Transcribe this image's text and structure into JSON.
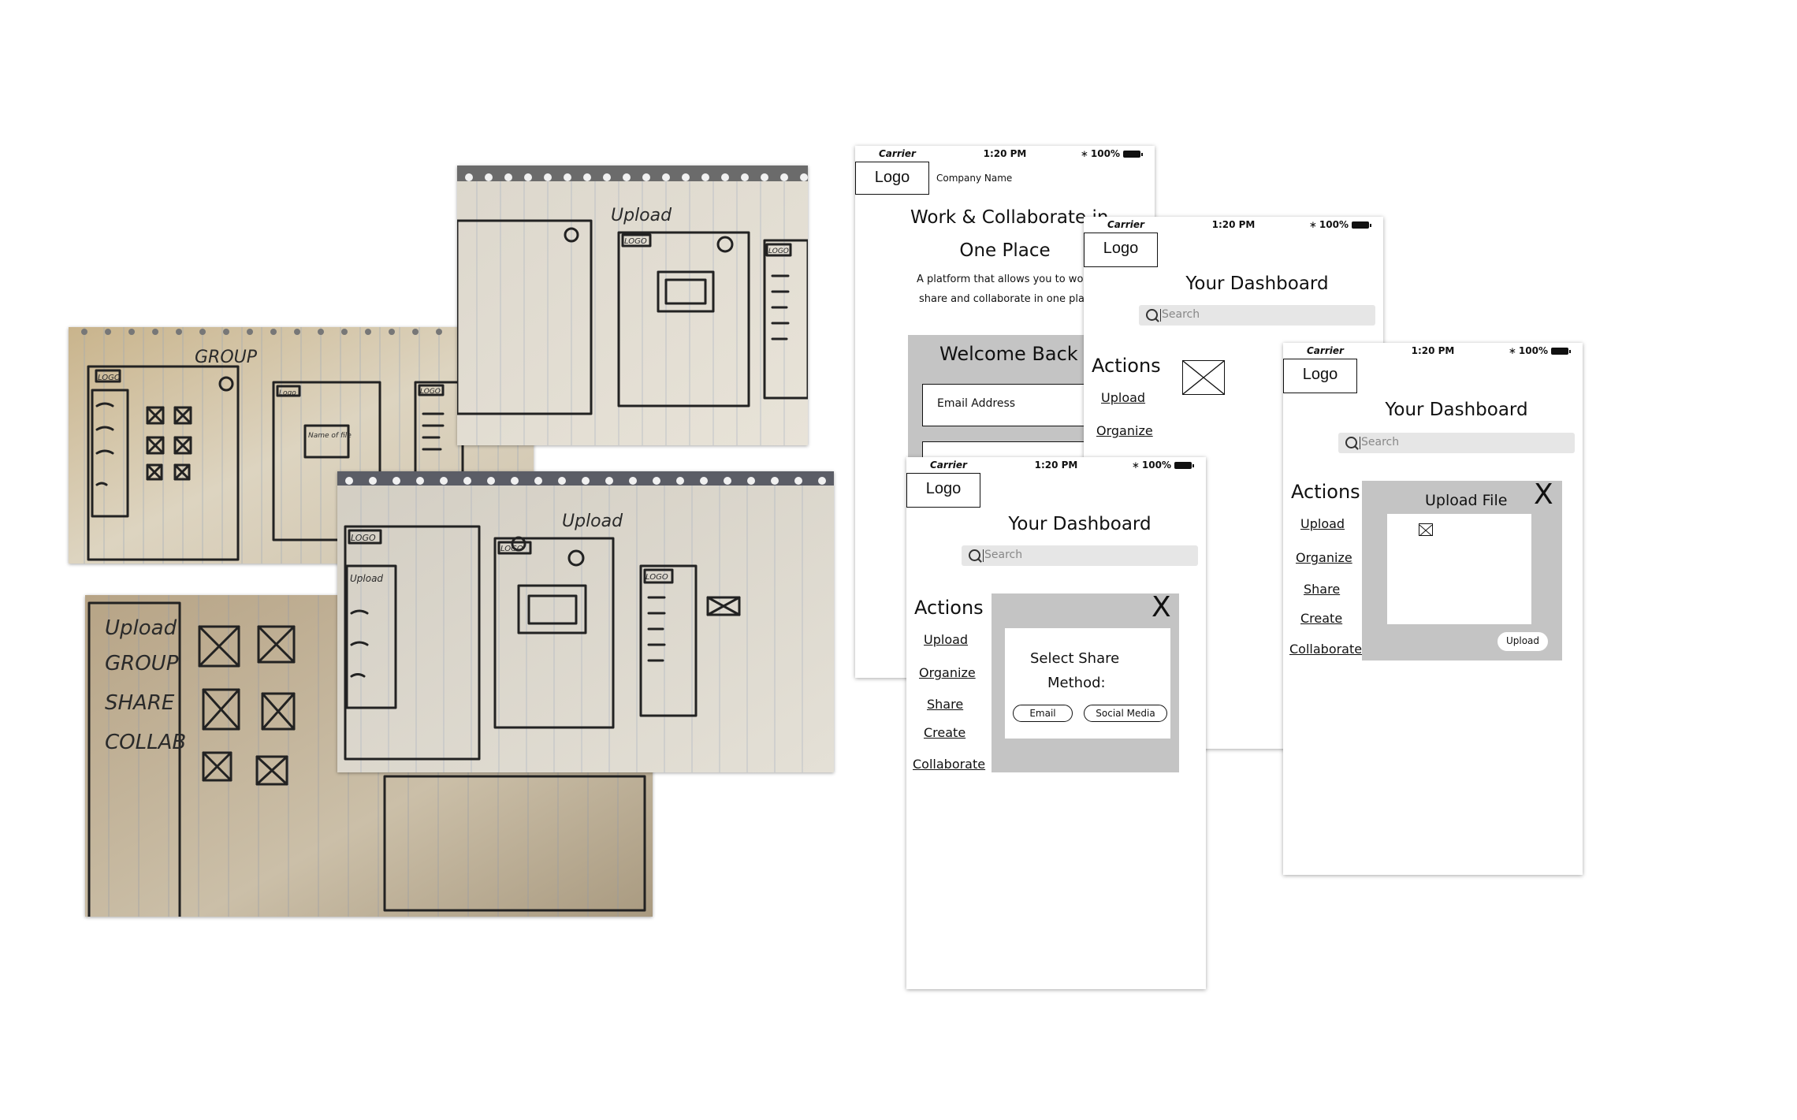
{
  "sketch_photos": {
    "group_photo": {
      "heading": "GROUP",
      "logo": "LOGO",
      "logo2": "Logo",
      "logo3": "LOGO",
      "note": "Name of file",
      "avatar": "A"
    },
    "upload_photo_top": {
      "heading": "Upload",
      "logo": "LOGO",
      "logo2": "LOGO",
      "avatar": "A"
    },
    "upload_photo_mid": {
      "heading": "Upload",
      "logo": "LOGO",
      "logo2": "LOGO",
      "logo3": "LOGO",
      "side_label": "Upload",
      "avatar": "A"
    },
    "menu_photo": {
      "items": [
        "Upload",
        "GROUP",
        "SHARE",
        "COLLAB"
      ]
    }
  },
  "screens": {
    "status": {
      "carrier": "Carrier",
      "time": "1:20 PM",
      "battery": "100%"
    },
    "landing": {
      "logo": "Logo",
      "company": "Company Name",
      "headline_line1": "Work & Collaborate in",
      "headline_line2": "One Place",
      "desc_line1": "A platform that allows you to work,",
      "desc_line2": "share and collaborate in one place",
      "welcome": "Welcome Back",
      "email_placeholder": "Email Address"
    },
    "dashboard_a": {
      "logo": "Logo",
      "title": "Your Dashboard",
      "search_placeholder": "Search",
      "actions_heading": "Actions",
      "actions": [
        "Upload",
        "Organize"
      ]
    },
    "dashboard_share": {
      "logo": "Logo",
      "title": "Your Dashboard",
      "search_placeholder": "Search",
      "actions_heading": "Actions",
      "actions": [
        "Upload",
        "Organize",
        "Share",
        "Create",
        "Collaborate"
      ],
      "close": "X",
      "modal_line1": "Select Share",
      "modal_line2": "Method:",
      "btn_email": "Email",
      "btn_social": "Social Media"
    },
    "dashboard_upload": {
      "logo": "Logo",
      "title": "Your Dashboard",
      "search_placeholder": "Search",
      "actions_heading": "Actions",
      "actions": [
        "Upload",
        "Organize",
        "Share",
        "Create",
        "Collaborate"
      ],
      "close": "X",
      "modal_title": "Upload File",
      "btn_upload": "Upload"
    }
  }
}
